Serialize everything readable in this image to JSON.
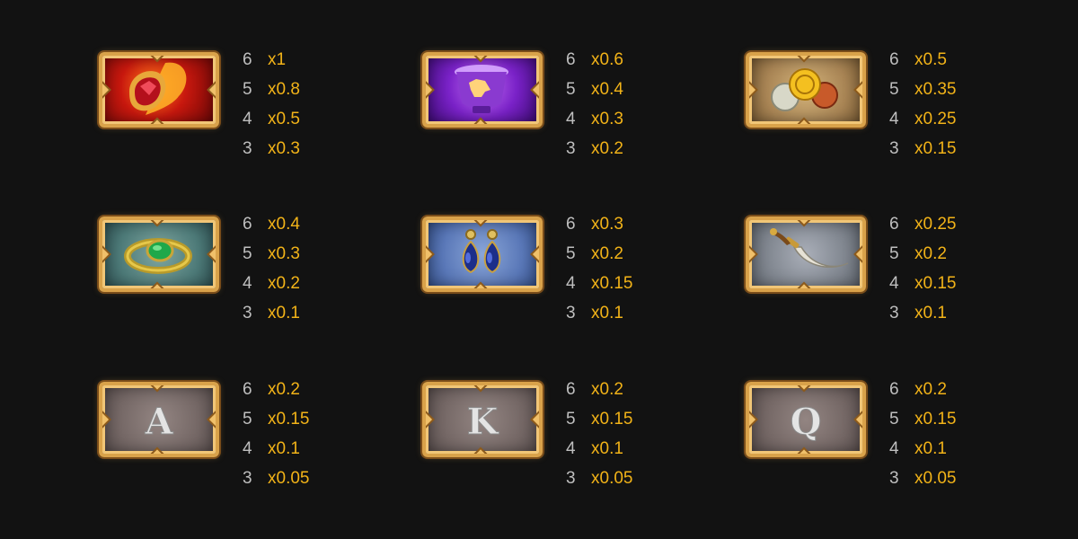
{
  "colors": {
    "background": "#121212",
    "count_text": "#bfbfbf",
    "multiplier_text": "#f2b318",
    "frame_gold": "#d9a24a"
  },
  "symbols": [
    {
      "symbol": "red-gem",
      "payouts": [
        {
          "count": "6",
          "mult": "x1"
        },
        {
          "count": "5",
          "mult": "x0.8"
        },
        {
          "count": "4",
          "mult": "x0.5"
        },
        {
          "count": "3",
          "mult": "x0.3"
        }
      ]
    },
    {
      "symbol": "purple-chalice",
      "payouts": [
        {
          "count": "6",
          "mult": "x0.6"
        },
        {
          "count": "5",
          "mult": "x0.4"
        },
        {
          "count": "4",
          "mult": "x0.3"
        },
        {
          "count": "3",
          "mult": "x0.2"
        }
      ]
    },
    {
      "symbol": "gold-coins",
      "payouts": [
        {
          "count": "6",
          "mult": "x0.5"
        },
        {
          "count": "5",
          "mult": "x0.35"
        },
        {
          "count": "4",
          "mult": "x0.25"
        },
        {
          "count": "3",
          "mult": "x0.15"
        }
      ]
    },
    {
      "symbol": "emerald-ring",
      "payouts": [
        {
          "count": "6",
          "mult": "x0.4"
        },
        {
          "count": "5",
          "mult": "x0.3"
        },
        {
          "count": "4",
          "mult": "x0.2"
        },
        {
          "count": "3",
          "mult": "x0.1"
        }
      ]
    },
    {
      "symbol": "sapphire-earrings",
      "payouts": [
        {
          "count": "6",
          "mult": "x0.3"
        },
        {
          "count": "5",
          "mult": "x0.2"
        },
        {
          "count": "4",
          "mult": "x0.15"
        },
        {
          "count": "3",
          "mult": "x0.1"
        }
      ]
    },
    {
      "symbol": "curved-dagger",
      "payouts": [
        {
          "count": "6",
          "mult": "x0.25"
        },
        {
          "count": "5",
          "mult": "x0.2"
        },
        {
          "count": "4",
          "mult": "x0.15"
        },
        {
          "count": "3",
          "mult": "x0.1"
        }
      ]
    },
    {
      "symbol": "letter-a",
      "letter": "A",
      "payouts": [
        {
          "count": "6",
          "mult": "x0.2"
        },
        {
          "count": "5",
          "mult": "x0.15"
        },
        {
          "count": "4",
          "mult": "x0.1"
        },
        {
          "count": "3",
          "mult": "x0.05"
        }
      ]
    },
    {
      "symbol": "letter-k",
      "letter": "K",
      "payouts": [
        {
          "count": "6",
          "mult": "x0.2"
        },
        {
          "count": "5",
          "mult": "x0.15"
        },
        {
          "count": "4",
          "mult": "x0.1"
        },
        {
          "count": "3",
          "mult": "x0.05"
        }
      ]
    },
    {
      "symbol": "letter-q",
      "letter": "Q",
      "payouts": [
        {
          "count": "6",
          "mult": "x0.2"
        },
        {
          "count": "5",
          "mult": "x0.15"
        },
        {
          "count": "4",
          "mult": "x0.1"
        },
        {
          "count": "3",
          "mult": "x0.05"
        }
      ]
    }
  ]
}
